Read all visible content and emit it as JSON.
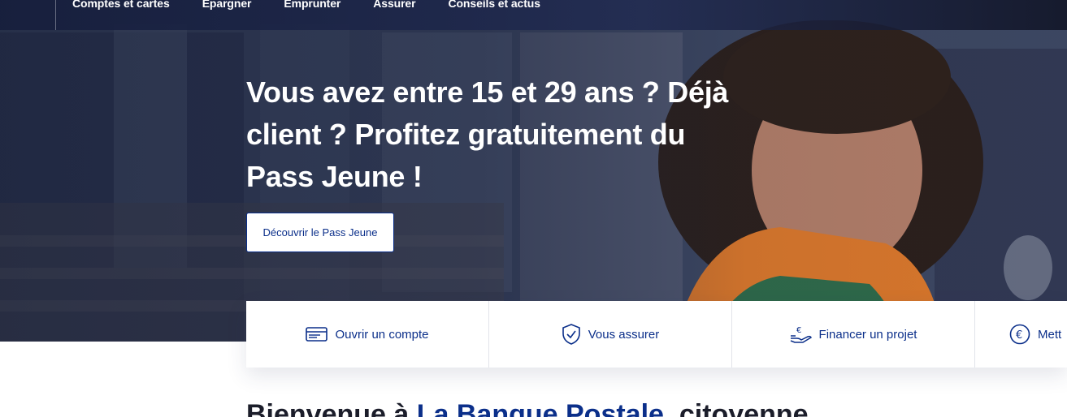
{
  "nav": {
    "items": [
      "Comptes et cartes",
      "Epargner",
      "Emprunter",
      "Assurer",
      "Conseils et actus"
    ]
  },
  "hero": {
    "title": "Vous avez entre 15 et 29 ans ? Déjà client ? Profitez gratuitement du Pass Jeune !",
    "cta_label": "Découvrir le Pass Jeune"
  },
  "quicklinks": [
    {
      "label": "Ouvrir un compte",
      "icon": "credit-card-icon"
    },
    {
      "label": "Vous assurer",
      "icon": "shield-check-icon"
    },
    {
      "label": "Financer un projet",
      "icon": "hand-euro-icon"
    },
    {
      "label": "Mett",
      "icon": "euro-circle-icon"
    }
  ],
  "welcome": {
    "prefix": "Bienvenue à ",
    "brand": "La Banque Postale",
    "suffix": ", citoyenne"
  },
  "colors": {
    "brand_blue": "#0b2f8a",
    "white": "#ffffff"
  }
}
